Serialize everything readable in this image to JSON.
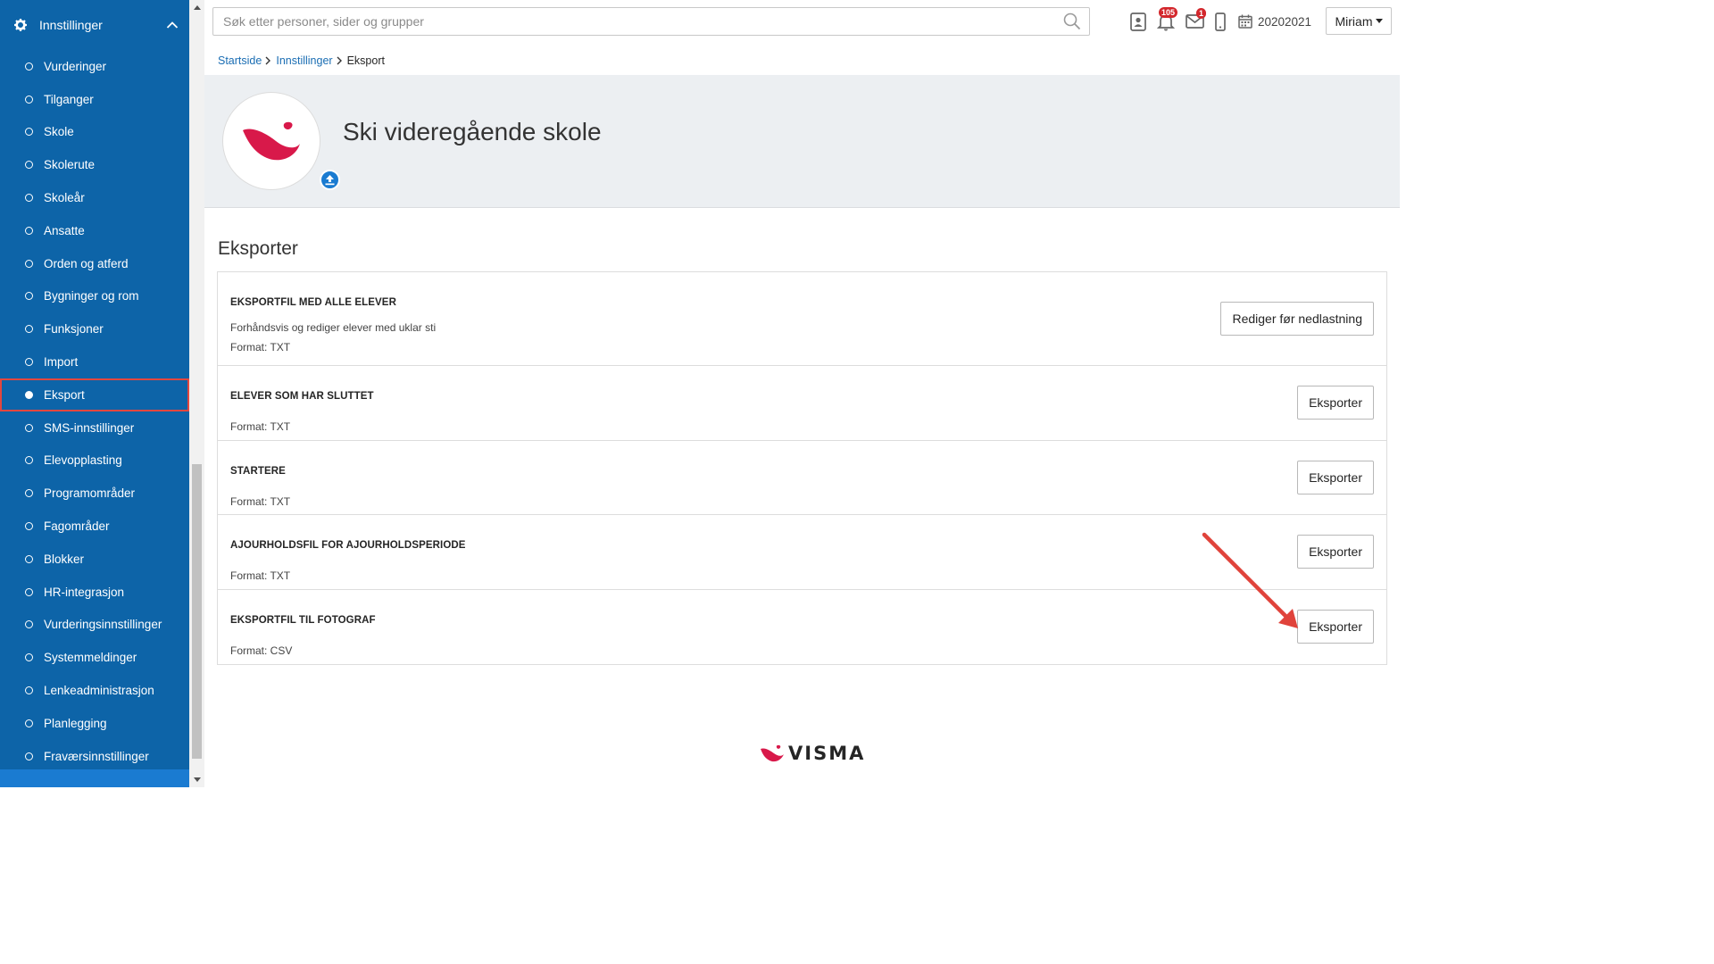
{
  "sidebar": {
    "header_label": "Innstillinger",
    "items": [
      {
        "label": "Vurderinger"
      },
      {
        "label": "Tilganger"
      },
      {
        "label": "Skole"
      },
      {
        "label": "Skolerute"
      },
      {
        "label": "Skoleår"
      },
      {
        "label": "Ansatte"
      },
      {
        "label": "Orden og atferd"
      },
      {
        "label": "Bygninger og rom"
      },
      {
        "label": "Funksjoner"
      },
      {
        "label": "Import"
      },
      {
        "label": "Eksport",
        "active": true
      },
      {
        "label": "SMS-innstillinger"
      },
      {
        "label": "Elevopplasting"
      },
      {
        "label": "Programområder"
      },
      {
        "label": "Fagområder"
      },
      {
        "label": "Blokker"
      },
      {
        "label": "HR-integrasjon"
      },
      {
        "label": "Vurderingsinnstillinger"
      },
      {
        "label": "Systemmeldinger"
      },
      {
        "label": "Lenkeadministrasjon"
      },
      {
        "label": "Planlegging"
      },
      {
        "label": "Fraværsinnstillinger"
      }
    ]
  },
  "topbar": {
    "search_placeholder": "Søk etter personer, sider og grupper",
    "notifications_count": "105",
    "messages_count": "1",
    "school_year": "20202021",
    "user_name": "Miriam"
  },
  "breadcrumb": {
    "items": [
      "Startside",
      "Innstillinger"
    ],
    "current": "Eksport"
  },
  "hero": {
    "school_name": "Ski videregående skole"
  },
  "export": {
    "section_title": "Eksporter",
    "rows": [
      {
        "title": "EKSPORTFIL MED ALLE ELEVER",
        "description": "Forhåndsvis og rediger elever med uklar sti",
        "format": "Format: TXT",
        "button": "Rediger før nedlastning"
      },
      {
        "title": "ELEVER SOM HAR SLUTTET",
        "format": "Format: TXT",
        "button": "Eksporter"
      },
      {
        "title": "STARTERE",
        "format": "Format: TXT",
        "button": "Eksporter"
      },
      {
        "title": "AJOURHOLDSFIL FOR AJOURHOLDSPERIODE",
        "format": "Format: TXT",
        "button": "Eksporter"
      },
      {
        "title": "EKSPORTFIL TIL FOTOGRAF",
        "format": "Format: CSV",
        "button": "Eksporter"
      }
    ]
  },
  "footer": {
    "brand": "VISMA"
  },
  "colors": {
    "sidebar_bg": "#0d64a8",
    "active_outline": "#e2473f",
    "link": "#1a6db3",
    "badge": "#d3272c",
    "brand_red": "#d8194a",
    "arrow": "#e0433b"
  }
}
